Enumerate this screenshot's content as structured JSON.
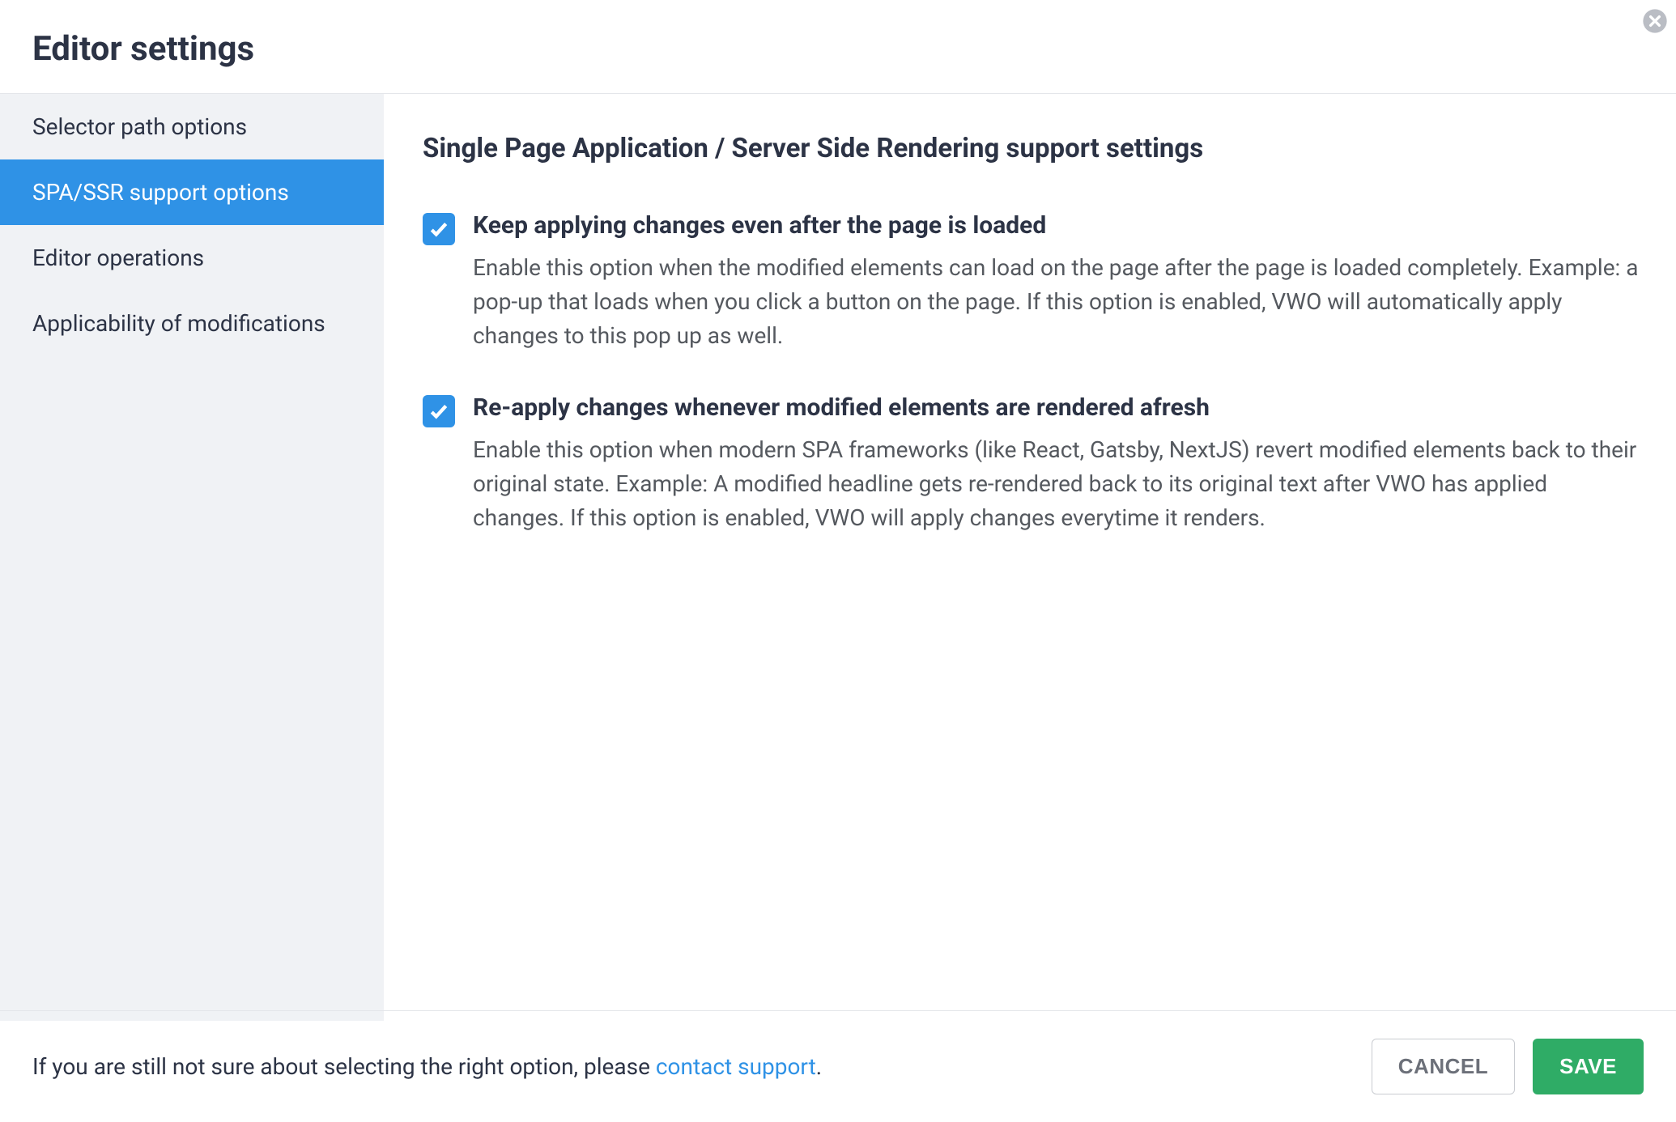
{
  "header": {
    "title": "Editor settings"
  },
  "sidebar": {
    "items": [
      {
        "label": "Selector path options",
        "active": false
      },
      {
        "label": "SPA/SSR support options",
        "active": true
      },
      {
        "label": "Editor operations",
        "active": false
      },
      {
        "label": "Applicability of modifications",
        "active": false
      }
    ]
  },
  "main": {
    "section_title": "Single Page Application / Server Side Rendering support settings",
    "settings": [
      {
        "checked": true,
        "label": "Keep applying changes even after the page is loaded",
        "description": "Enable this option when the modified elements can load on the page after the page is loaded completely. Example: a pop-up that loads when you click a button on the page. If this option is enabled, VWO will automatically apply changes to this pop up as well."
      },
      {
        "checked": true,
        "label": "Re-apply changes whenever modified elements are rendered afresh",
        "description": "Enable this option when modern SPA frameworks (like React, Gatsby, NextJS) revert modified elements back to their original state. Example: A modified headline gets re-rendered back to its original text after VWO has applied changes. If this option is enabled, VWO will apply changes everytime it renders."
      }
    ]
  },
  "footer": {
    "help_text_prefix": "If you are still not sure about selecting the right option, please ",
    "help_link": "contact support",
    "help_text_suffix": ".",
    "cancel_label": "CANCEL",
    "save_label": "SAVE"
  }
}
